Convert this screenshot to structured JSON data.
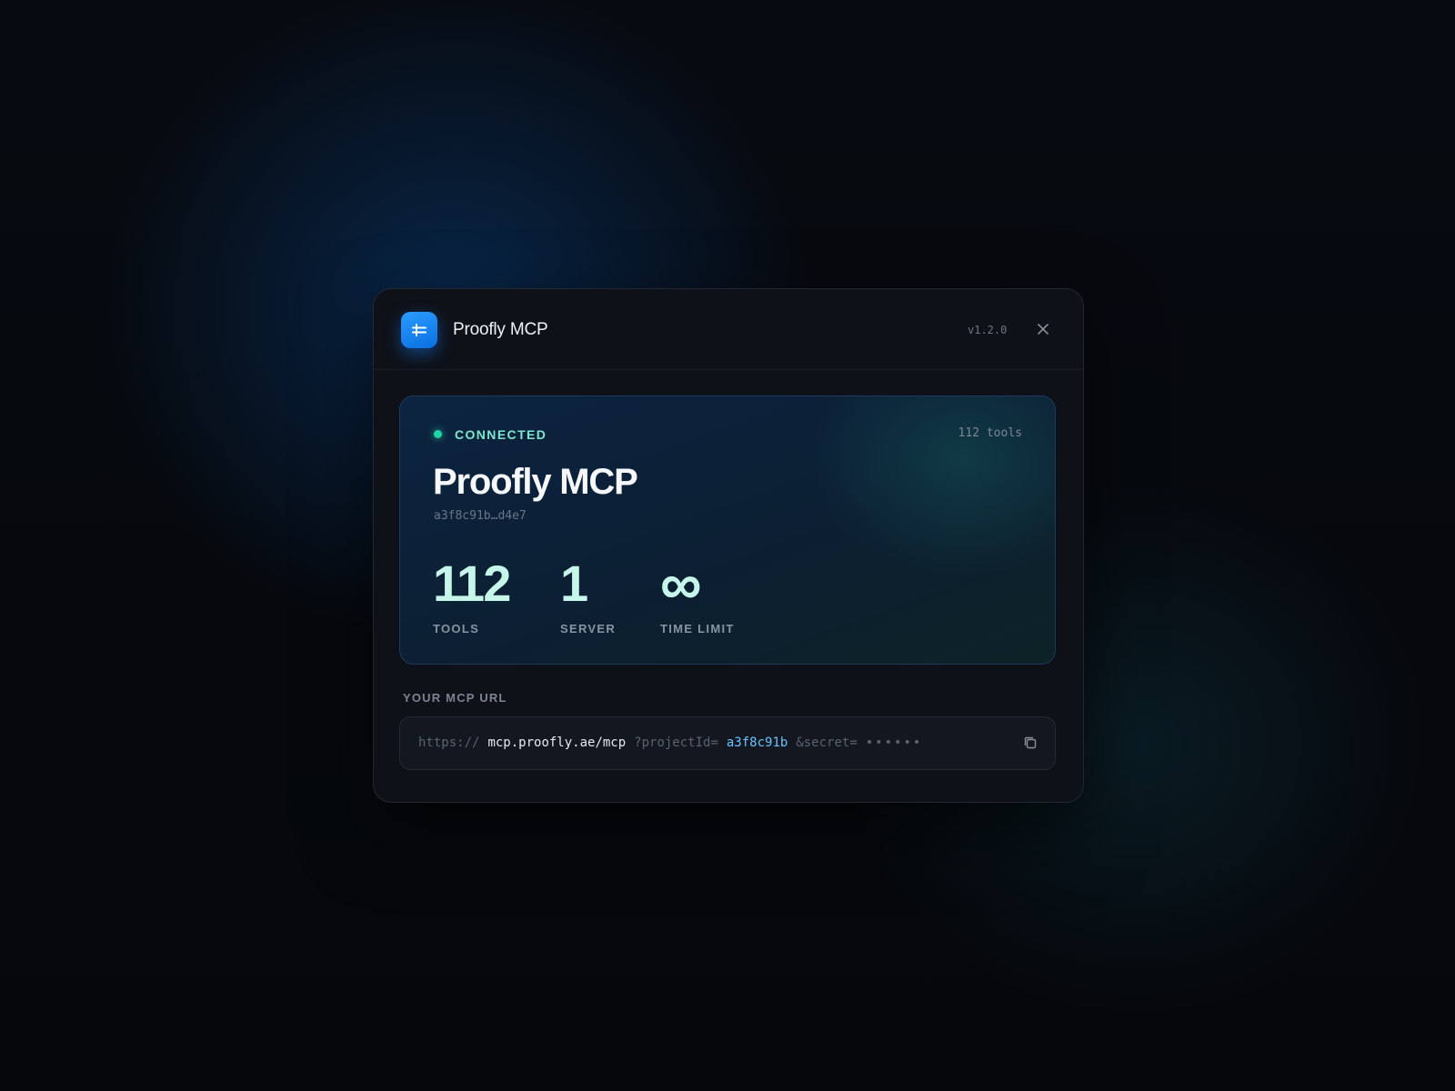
{
  "window": {
    "title": "Proofly MCP",
    "version": "v1.2.0",
    "logo_icon": "sliders-icon",
    "close_icon": "close-icon"
  },
  "status_card": {
    "status": "CONNECTED",
    "status_color": "#22d3a4",
    "tools_count": "112 tools",
    "server_name": "Proofly MCP",
    "server_id": "a3f8c91b…d4e7",
    "stats": [
      {
        "value": "112",
        "label": "TOOLS"
      },
      {
        "value": "1",
        "label": "SERVER"
      },
      {
        "value": "∞",
        "label": "TIME LIMIT"
      }
    ]
  },
  "mcp_url": {
    "heading": "YOUR MCP URL",
    "scheme": "https://",
    "host": "mcp.proofly.ae/mcp",
    "project_param": "?projectId=",
    "project_id": "a3f8c91b",
    "secret_param": "&secret=",
    "secret_mask": "••••••",
    "copy_icon": "copy-icon"
  },
  "colors": {
    "accent": "#1a86f5",
    "stat_value": "#c6f5e9",
    "project_id": "#6cc0ff"
  }
}
